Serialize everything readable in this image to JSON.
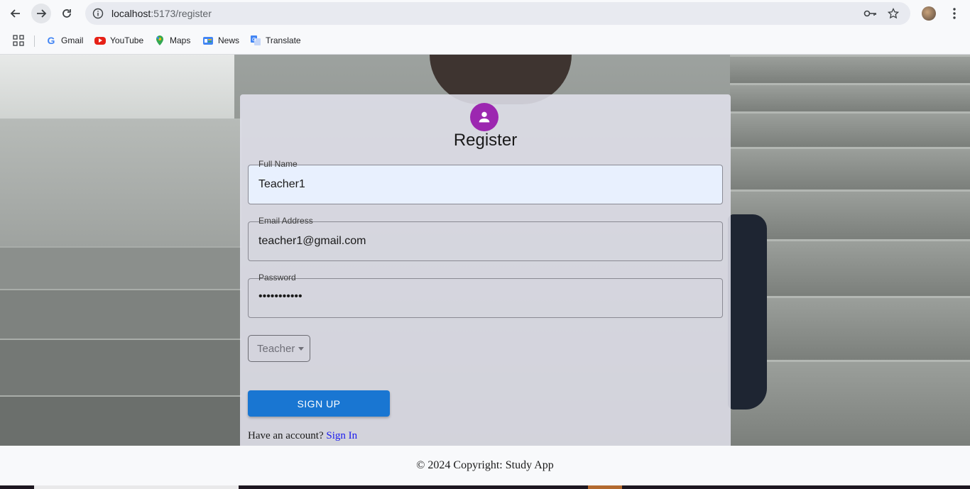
{
  "browser": {
    "url_host": "localhost",
    "url_path": ":5173/register",
    "bookmarks": [
      {
        "label": "Gmail",
        "icon": "gmail-icon"
      },
      {
        "label": "YouTube",
        "icon": "youtube-icon"
      },
      {
        "label": "Maps",
        "icon": "maps-icon"
      },
      {
        "label": "News",
        "icon": "news-icon"
      },
      {
        "label": "Translate",
        "icon": "translate-icon"
      }
    ]
  },
  "form": {
    "title": "Register",
    "full_name": {
      "label": "Full Name",
      "value": "Teacher1"
    },
    "email": {
      "label": "Email Address",
      "value": "teacher1@gmail.com"
    },
    "password": {
      "label": "Password",
      "value": "•••••••••••"
    },
    "role": {
      "selected": "Teacher"
    },
    "submit_label": "SIGN UP",
    "have_account_text": "Have an account?",
    "sign_in_label": "Sign In"
  },
  "footer": {
    "text": "© 2024 Copyright: Study App"
  },
  "colors": {
    "accent": "#1976d2",
    "avatar": "#9c27b0",
    "link": "#1a1aee"
  }
}
